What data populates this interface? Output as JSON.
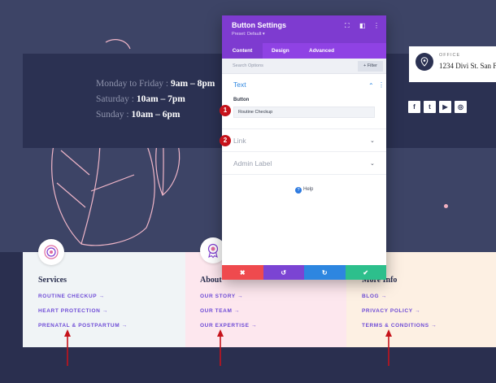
{
  "hours": {
    "lines": [
      {
        "day": "Monday to Friday :",
        "time": "9am – 8pm"
      },
      {
        "day": "Saturday :",
        "time": "10am – 7pm"
      },
      {
        "day": "Sunday :",
        "time": "10am – 6pm"
      }
    ]
  },
  "office": {
    "label": "OFFICE",
    "address": "1234 Divi St. San F",
    "icon": "map-pin-icon"
  },
  "socials": [
    {
      "icon": "facebook-icon",
      "glyph": "f"
    },
    {
      "icon": "twitter-icon",
      "glyph": "t"
    },
    {
      "icon": "youtube-icon",
      "glyph": "▶"
    },
    {
      "icon": "instagram-icon",
      "glyph": "◎"
    }
  ],
  "columns": [
    {
      "title": "Services",
      "links": [
        "ROUTINE CHECKUP →",
        "HEART PROTECTION →",
        "PRENATAL & POSTPARTUM →"
      ]
    },
    {
      "title": "About",
      "links": [
        "OUR STORY →",
        "OUR TEAM →",
        "OUR EXPERTISE →"
      ]
    },
    {
      "title": "More Info",
      "links": [
        "BLOG →",
        "PRIVACY POLICY →",
        "TERMS & CONDITIONS →"
      ]
    }
  ],
  "modal": {
    "title": "Button Settings",
    "preset": "Preset: Default ▾",
    "header_icons": [
      "expand-icon",
      "sidebar-icon",
      "more-icon"
    ],
    "tabs": [
      "Content",
      "Design",
      "Advanced"
    ],
    "active_tab": "Content",
    "search_placeholder": "Search Options",
    "filter_label": "+ Filter",
    "sections": {
      "text": {
        "title": "Text",
        "field_label": "Button",
        "field_value": "Routine Checkup"
      },
      "link": {
        "title": "Link"
      },
      "admin": {
        "title": "Admin Label"
      }
    },
    "help_label": "Help",
    "footer_buttons": [
      {
        "name": "discard-button",
        "glyph": "✖",
        "color": "#ef4a4e"
      },
      {
        "name": "undo-button",
        "glyph": "↺",
        "color": "#7b44d3"
      },
      {
        "name": "redo-button",
        "glyph": "↻",
        "color": "#2d86e0"
      },
      {
        "name": "save-button",
        "glyph": "✔",
        "color": "#2dbf8c"
      }
    ]
  },
  "markers": [
    "1",
    "2"
  ],
  "colors": {
    "accent_purple": "#7e3bd0",
    "link_purple": "#6d4ad6",
    "marker_red": "#c6131b",
    "navy": "#2b3152"
  }
}
